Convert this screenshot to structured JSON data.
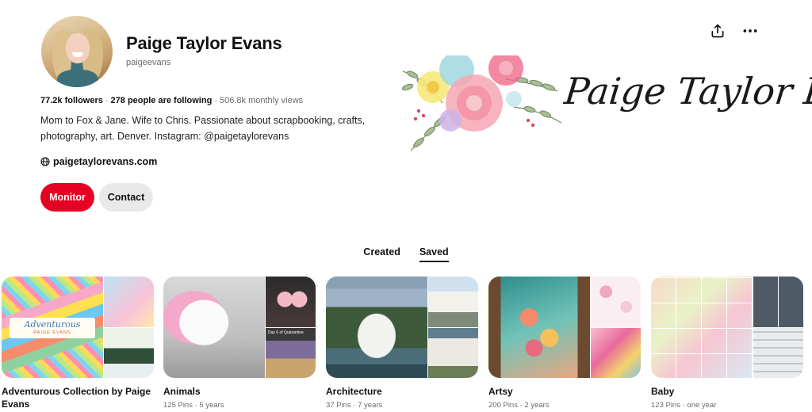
{
  "profile": {
    "name": "Paige Taylor Evans",
    "handle": "paigeevans",
    "followers": "77.2k followers",
    "following": "278 people are following",
    "monthly_views": "506.8k monthly views",
    "bio": "Mom to Fox & Jane. Wife to Chris. Passionate about scrapbooking, crafts, photography, art. Denver. Instagram: @paigetaylorevans",
    "website": "paigetaylorevans.com",
    "cover_text": "Paige Taylor Evans"
  },
  "actions": {
    "monitor_label": "Monitor",
    "contact_label": "Contact"
  },
  "icons": {
    "share": "share-icon",
    "more": "more-icon",
    "globe": "globe-icon"
  },
  "tabs": [
    {
      "label": "Created",
      "active": false
    },
    {
      "label": "Saved",
      "active": true
    }
  ],
  "boards": [
    {
      "title": "Adventurous Collection by Paige Evans",
      "meta": "",
      "thumb_label": "Adventurous",
      "thumb_sublabel": "PAIGE EVANS"
    },
    {
      "title": "Animals",
      "meta": "125 Pins · 5 years",
      "thumb_label": "Day 6 of Quarantine"
    },
    {
      "title": "Architecture",
      "meta": "37 Pins · 7 years"
    },
    {
      "title": "Artsy",
      "meta": "200 Pins · 2 years"
    },
    {
      "title": "Baby",
      "meta": "123 Pins · one year"
    }
  ],
  "colors": {
    "brand_red": "#e60023",
    "button_gray": "#e9e9e9",
    "text_muted": "#6b6b6b"
  }
}
